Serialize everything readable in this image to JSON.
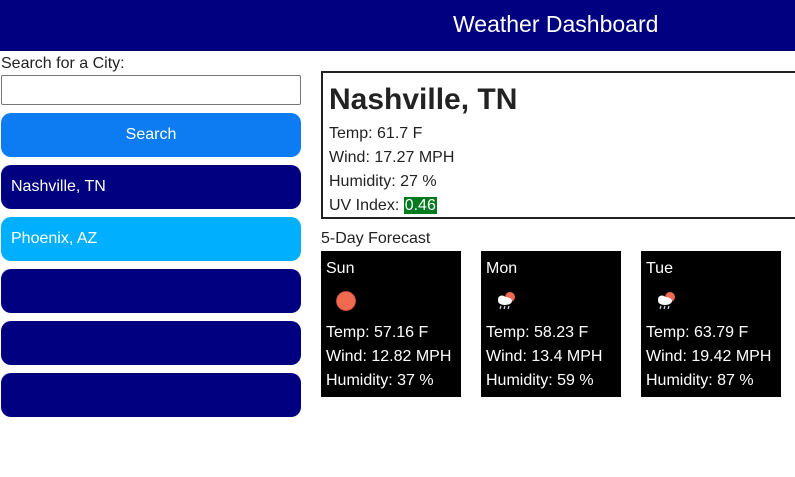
{
  "header": {
    "title": "Weather Dashboard"
  },
  "search": {
    "label": "Search for a City:",
    "value": "",
    "placeholder": "",
    "button_label": "Search"
  },
  "history": [
    {
      "label": "Nashville, TN"
    },
    {
      "label": "Phoenix, AZ"
    },
    {
      "label": ""
    },
    {
      "label": ""
    },
    {
      "label": ""
    }
  ],
  "current": {
    "city": "Nashville, TN",
    "temp": "Temp: 61.7 F",
    "wind": "Wind: 17.27 MPH",
    "humidity": "Humidity: 27 %",
    "uv_label": "UV Index: ",
    "uv_value": "0.46",
    "uv_color": "#007a1f"
  },
  "forecast": {
    "label": "5-Day Forecast",
    "days": [
      {
        "day": "Sun",
        "icon": "clear-sun-icon",
        "temp": "Temp: 57.16 F",
        "wind": "Wind: 12.82 MPH",
        "humidity": "Humidity: 37 %"
      },
      {
        "day": "Mon",
        "icon": "sun-rain-cloud-icon",
        "temp": "Temp: 58.23 F",
        "wind": "Wind: 13.4 MPH",
        "humidity": "Humidity: 59 %"
      },
      {
        "day": "Tue",
        "icon": "sun-rain-cloud-icon",
        "temp": "Temp: 63.79 F",
        "wind": "Wind: 19.42 MPH",
        "humidity": "Humidity: 87 %"
      }
    ]
  },
  "colors": {
    "header_bg": "#000080",
    "search_button": "#0d7cf2",
    "history_button": "#000080",
    "history_active": "#00b0ff",
    "card_bg": "#000000"
  }
}
